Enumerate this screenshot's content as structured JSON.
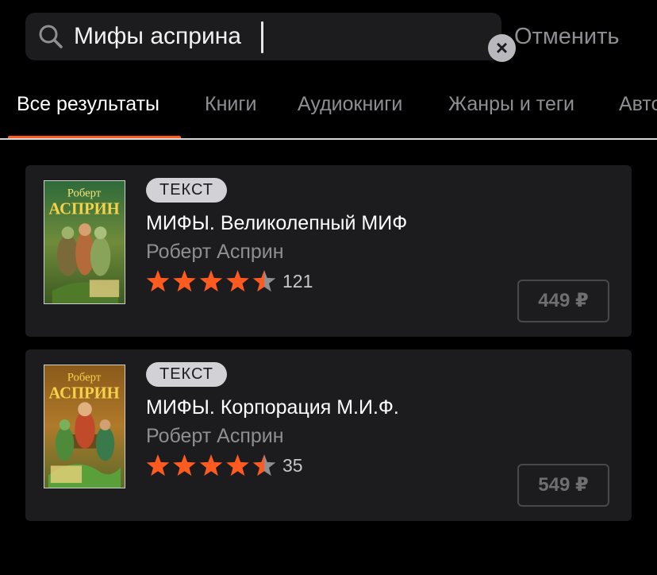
{
  "search": {
    "query": "Мифы асприна",
    "cancel_label": "Отменить",
    "clear_icon": "×"
  },
  "tabs": [
    {
      "label": "Все результаты",
      "active": true
    },
    {
      "label": "Книги",
      "active": false
    },
    {
      "label": "Аудиокниги",
      "active": false
    },
    {
      "label": "Жанры и теги",
      "active": false
    },
    {
      "label": "Авто",
      "active": false
    }
  ],
  "results": [
    {
      "badge": "ТЕКСТ",
      "title": "МИФЫ. Великолепный МИФ",
      "author": "Роберт Асприн",
      "rating": 4.5,
      "rating_count": "121",
      "price": "449 ₽",
      "cover_text": [
        "Роберт",
        "АСПРИН"
      ]
    },
    {
      "badge": "ТЕКСТ",
      "title": "МИФЫ. Корпорация М.И.Ф.",
      "author": "Роберт Асприн",
      "rating": 4.5,
      "rating_count": "35",
      "price": "549 ₽",
      "cover_text": [
        "Роберт",
        "АСПРИН"
      ]
    }
  ],
  "colors": {
    "accent": "#ff5a1f",
    "star_filled": "#ff5a1f",
    "star_empty": "#8e8e93",
    "card_bg": "#1c1c1e"
  }
}
